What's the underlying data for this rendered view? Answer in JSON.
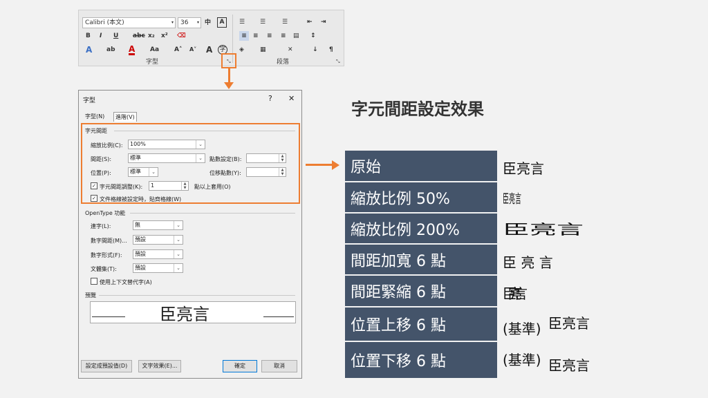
{
  "ribbon": {
    "font_name": "Calibri (本文)",
    "font_size": "36",
    "bold": "B",
    "italic": "I",
    "underline": "U",
    "strike": "abc",
    "subscript": "x₂",
    "superscript": "x²",
    "font_color": "A",
    "case": "Aa",
    "grow": "A˄",
    "shrink": "A˅",
    "char_border": "A",
    "phonetic": "字",
    "font_group": "字型",
    "paragraph_group": "段落"
  },
  "dialog": {
    "title": "字型",
    "help": "?",
    "close": "✕",
    "tabs": [
      "字型(N)",
      "進階(V)"
    ],
    "spacing_section": "字元間距",
    "scale_label": "縮放比例(C):",
    "scale_value": "100%",
    "spacing_label": "間距(S):",
    "spacing_value": "標準",
    "by_label": "點數設定(B):",
    "position_label": "位置(P):",
    "position_value": "標準",
    "offset_label": "位移點數(Y):",
    "kerning_label": "字元間距調整(K):",
    "kerning_value": "1",
    "kerning_suffix": "點以上套用(O)",
    "snap_label": "文件格線被設定時，貼齊格線(W)",
    "opentype_section": "OpenType 功能",
    "ligatures_label": "連字(L):",
    "ligatures_value": "無",
    "num_spacing_label": "數字間距(M)...",
    "num_spacing_value": "預設",
    "num_forms_label": "數字形式(F):",
    "num_forms_value": "預設",
    "stylistic_label": "文體集(T):",
    "stylistic_value": "預設",
    "contextual_label": "使用上下文替代字(A)",
    "preview_section": "預覽",
    "preview_text": "臣亮言",
    "default_button": "設定成預設值(D)",
    "effects_button": "文字效果(E)...",
    "ok_button": "確定",
    "cancel_button": "取消"
  },
  "heading": "字元間距設定效果",
  "rows": [
    {
      "label": "原始",
      "example": "臣亮言"
    },
    {
      "label": "縮放比例 50%",
      "example": "臣亮言"
    },
    {
      "label": "縮放比例 200%",
      "example": "臣亮言"
    },
    {
      "label": "間距加寬 6 點",
      "example": "臣 亮 言"
    },
    {
      "label": "間距緊縮 6 點",
      "example": "臣亮言"
    },
    {
      "label": "位置上移 6 點",
      "baseline": "(基準)",
      "example": "臣亮言"
    },
    {
      "label": "位置下移 6 點",
      "baseline": "(基準)",
      "example": "臣亮言"
    }
  ],
  "colors": {
    "accent": "#ed7d31",
    "table_fill": "#44546a"
  }
}
